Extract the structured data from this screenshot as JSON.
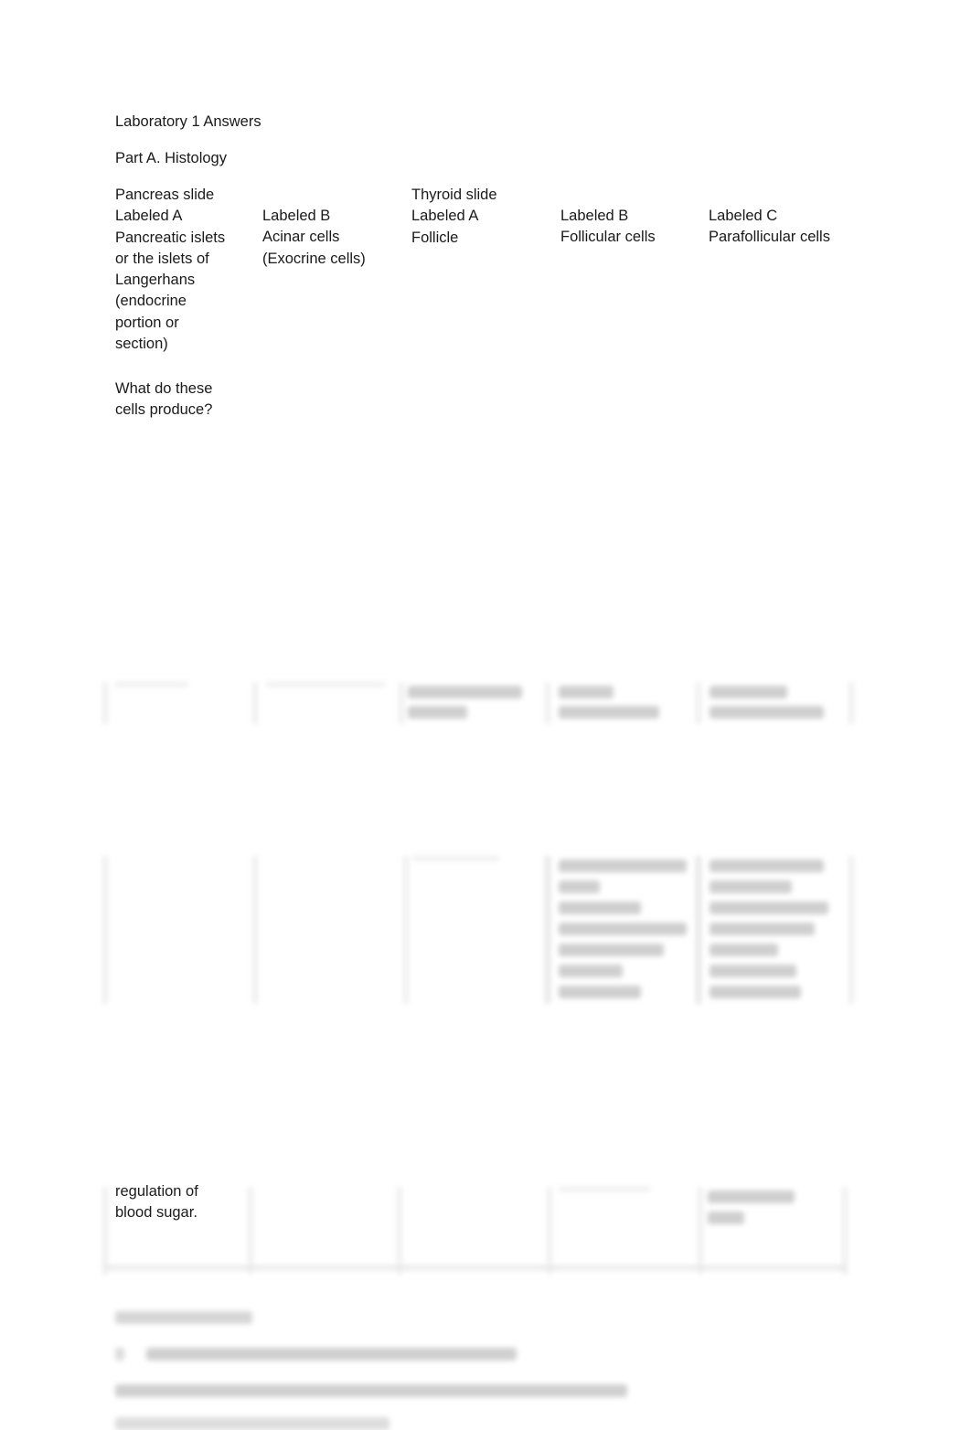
{
  "document": {
    "title": "Laboratory 1 Answers",
    "section": "Part A.  Histology",
    "columns": [
      {
        "heading": "Pancreas slide",
        "label": "Labeled A",
        "lines": [
          "Pancreatic islets",
          "or the islets of",
          "Langerhans",
          "(endocrine",
          "portion or",
          "section)"
        ]
      },
      {
        "heading": "",
        "label": "Labeled B",
        "lines": [
          "Acinar cells",
          "(Exocrine cells)"
        ]
      },
      {
        "heading": "Thyroid slide",
        "label": "Labeled A",
        "lines": [
          "Follicle"
        ]
      },
      {
        "heading": "",
        "label": "Labeled B",
        "lines": [
          "Follicular cells"
        ]
      },
      {
        "heading": "",
        "label": "Labeled C",
        "lines": [
          "Parafollicular cells"
        ]
      }
    ],
    "question": [
      "What do these",
      "cells produce?"
    ],
    "visible_answer_fragment": [
      "regulation of",
      "blood sugar."
    ]
  }
}
